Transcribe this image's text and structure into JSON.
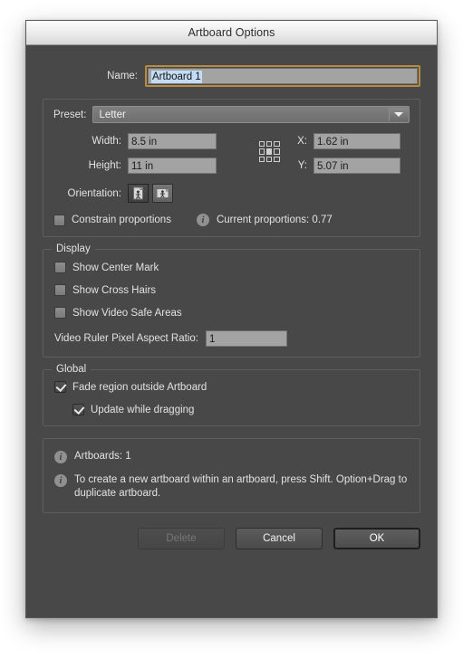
{
  "window": {
    "title": "Artboard Options"
  },
  "name_row": {
    "label": "Name:",
    "value": "Artboard 1"
  },
  "preset": {
    "label": "Preset:",
    "value": "Letter",
    "arrow_icon": "chevron-down-icon"
  },
  "dimensions": {
    "width_label": "Width:",
    "width_value": "8.5 in",
    "height_label": "Height:",
    "height_value": "11 in",
    "x_label": "X:",
    "x_value": "1.62 in",
    "y_label": "Y:",
    "y_value": "5.07 in",
    "anchor_icon": "reference-point-grid-icon"
  },
  "orientation": {
    "label": "Orientation:",
    "portrait_icon": "portrait-orientation-icon",
    "landscape_icon": "landscape-orientation-icon",
    "selected": "portrait"
  },
  "constrain": {
    "label": "Constrain proportions",
    "checked": false,
    "info_icon": "info-icon",
    "current_proportions": "Current proportions: 0.77"
  },
  "display": {
    "legend": "Display",
    "checkboxes": [
      {
        "label": "Show Center Mark",
        "checked": false
      },
      {
        "label": "Show Cross Hairs",
        "checked": false
      },
      {
        "label": "Show Video Safe Areas",
        "checked": false
      }
    ],
    "video_ruler_label": "Video Ruler Pixel Aspect Ratio:",
    "video_ruler_value": "1"
  },
  "global": {
    "legend": "Global",
    "fade_label": "Fade region outside Artboard",
    "fade_checked": true,
    "update_label": "Update while dragging",
    "update_checked": true
  },
  "info": {
    "artboards_count": "Artboards: 1",
    "hint": "To create a new artboard within an artboard, press Shift. Option+Drag to duplicate artboard.",
    "icon": "info-icon"
  },
  "buttons": {
    "delete": "Delete",
    "cancel": "Cancel",
    "ok": "OK"
  },
  "colors": {
    "dialog_bg": "#484848",
    "field_bg": "#a3a3a3",
    "focus_ring": "#b98b3e",
    "selection": "#c3ddf4",
    "text": "#e2e2e2"
  }
}
